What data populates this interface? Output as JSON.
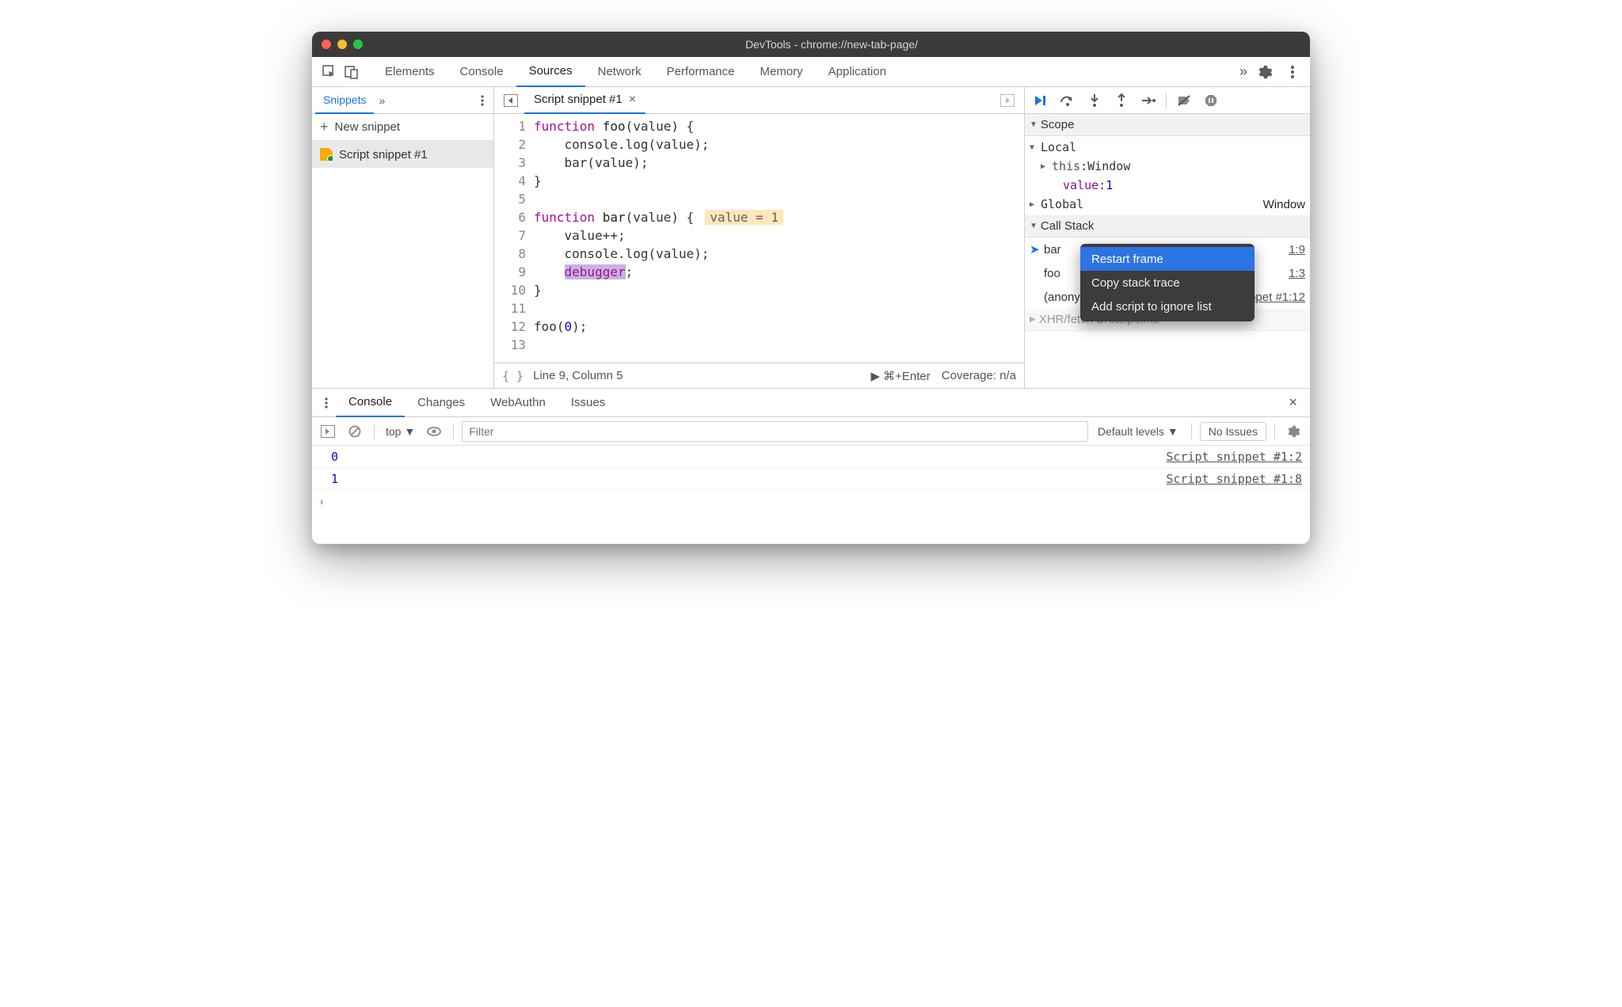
{
  "window": {
    "title": "DevTools - chrome://new-tab-page/"
  },
  "mainTabs": [
    "Elements",
    "Console",
    "Sources",
    "Network",
    "Performance",
    "Memory",
    "Application"
  ],
  "mainTabActive": "Sources",
  "leftPane": {
    "tab": "Snippets",
    "newSnippet": "New snippet",
    "items": [
      "Script snippet #1"
    ]
  },
  "editor": {
    "tab": "Script snippet #1",
    "lines": [
      {
        "n": 1,
        "tokens": [
          {
            "t": "function",
            "c": "kw"
          },
          {
            "t": " "
          },
          {
            "t": "foo",
            "c": "fn"
          },
          {
            "t": "(value) {"
          }
        ]
      },
      {
        "n": 2,
        "tokens": [
          {
            "t": "    console.log(value);"
          }
        ]
      },
      {
        "n": 3,
        "tokens": [
          {
            "t": "    bar(value);"
          }
        ]
      },
      {
        "n": 4,
        "tokens": [
          {
            "t": "}"
          }
        ]
      },
      {
        "n": 5,
        "tokens": []
      },
      {
        "n": 6,
        "tokens": [
          {
            "t": "function",
            "c": "kw"
          },
          {
            "t": " "
          },
          {
            "t": "bar",
            "c": "fn"
          },
          {
            "t": "(value) {"
          }
        ],
        "inline": "value = 1"
      },
      {
        "n": 7,
        "tokens": [
          {
            "t": "    value++;"
          }
        ]
      },
      {
        "n": 8,
        "tokens": [
          {
            "t": "    console.log(value);"
          }
        ]
      },
      {
        "n": 9,
        "tokens": [
          {
            "t": "    "
          },
          {
            "t": "debugger",
            "c": "kw debug-hl"
          },
          {
            "t": ";"
          }
        ],
        "highlight": true
      },
      {
        "n": 10,
        "tokens": [
          {
            "t": "}"
          }
        ]
      },
      {
        "n": 11,
        "tokens": []
      },
      {
        "n": 12,
        "tokens": [
          {
            "t": "foo("
          },
          {
            "t": "0",
            "c": "num"
          },
          {
            "t": ");"
          }
        ]
      },
      {
        "n": 13,
        "tokens": []
      }
    ],
    "status": {
      "position": "Line 9, Column 5",
      "run": "⌘+Enter",
      "coverage": "Coverage: n/a"
    }
  },
  "debugger": {
    "scope": {
      "title": "Scope",
      "local": {
        "label": "Local",
        "this": {
          "name": "this",
          "value": "Window"
        },
        "value": {
          "name": "value",
          "value": "1"
        }
      },
      "global": {
        "label": "Global",
        "value": "Window"
      }
    },
    "callStack": {
      "title": "Call Stack",
      "frames": [
        {
          "name": "bar",
          "loc": "1:9",
          "current": true
        },
        {
          "name": "foo",
          "loc": "1:3"
        },
        {
          "name": "(anonymous)",
          "loc": "Script snippet #1:12"
        }
      ]
    },
    "xhr": "XHR/fetch Breakpoints",
    "contextMenu": [
      "Restart frame",
      "Copy stack trace",
      "Add script to ignore list"
    ]
  },
  "drawer": {
    "tabs": [
      "Console",
      "Changes",
      "WebAuthn",
      "Issues"
    ],
    "active": "Console"
  },
  "console": {
    "context": "top",
    "filterPlaceholder": "Filter",
    "levels": "Default levels",
    "noIssues": "No Issues",
    "logs": [
      {
        "value": "0",
        "source": "Script snippet #1:2"
      },
      {
        "value": "1",
        "source": "Script snippet #1:8"
      }
    ]
  }
}
